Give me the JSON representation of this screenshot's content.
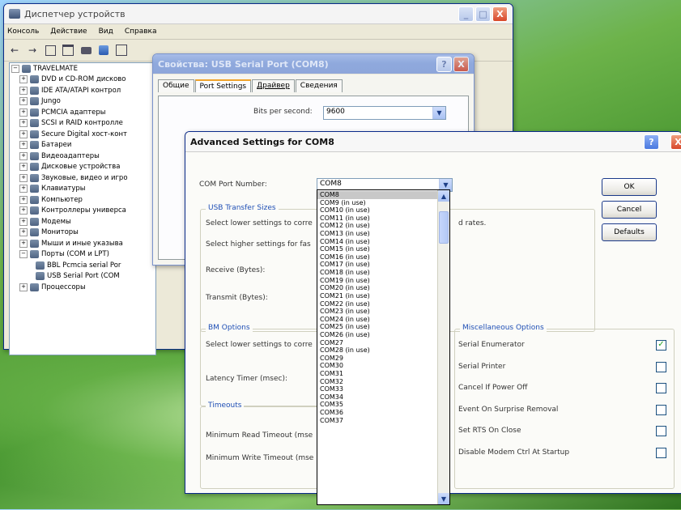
{
  "device_manager": {
    "title": "Диспетчер устройств",
    "menu": [
      "Консоль",
      "Действие",
      "Вид",
      "Справка"
    ],
    "tree": [
      {
        "label": "TRAVELMATE",
        "root": true
      },
      {
        "label": "DVD и CD-ROM дисково"
      },
      {
        "label": "IDE ATA/ATAPI контрол"
      },
      {
        "label": "Jungo"
      },
      {
        "label": "PCMCIA адаптеры"
      },
      {
        "label": "SCSI и RAID контролле"
      },
      {
        "label": "Secure Digital хост-конт"
      },
      {
        "label": "Батареи"
      },
      {
        "label": "Видеоадаптеры"
      },
      {
        "label": "Дисковые устройства"
      },
      {
        "label": "Звуковые, видео и игро"
      },
      {
        "label": "Клавиатуры"
      },
      {
        "label": "Компьютер"
      },
      {
        "label": "Контроллеры универса"
      },
      {
        "label": "Модемы"
      },
      {
        "label": "Мониторы"
      },
      {
        "label": "Мыши и иные указыва"
      },
      {
        "label": "Порты (COM и LPT)"
      },
      {
        "label": "BBL Pcmcia serial Por",
        "child": true
      },
      {
        "label": "USB Serial Port (COM",
        "child": true
      },
      {
        "label": "Процессоры"
      }
    ]
  },
  "properties": {
    "title": "Свойства: USB Serial Port (COM8)",
    "help": "?",
    "close": "X",
    "tabs": [
      "Общие",
      "Port Settings",
      "Драйвер",
      "Сведения"
    ],
    "bits_label": "Bits per second:",
    "bits_value": "9600"
  },
  "advanced": {
    "title": "Advanced Settings for COM8",
    "help": "?",
    "com_port_label": "COM Port Number:",
    "com_port_value": "COM8",
    "usb_section": "USB Transfer Sizes",
    "usb_line1": "Select lower settings to corre",
    "usb_line1_tail": "d rates.",
    "usb_line2": "Select higher settings for fas",
    "receive_label": "Receive (Bytes):",
    "transmit_label": "Transmit (Bytes):",
    "bm_section": "BM Options",
    "bm_line": "Select lower settings to corre",
    "latency_label": "Latency Timer (msec):",
    "timeouts_section": "Timeouts",
    "min_read_label": "Minimum Read Timeout (mse",
    "min_write_label": "Minimum Write Timeout (mse",
    "misc_section": "Miscellaneous Options",
    "misc_options": [
      {
        "label": "Serial Enumerator",
        "checked": true
      },
      {
        "label": "Serial Printer",
        "checked": false
      },
      {
        "label": "Cancel If Power Off",
        "checked": false
      },
      {
        "label": "Event On Surprise Removal",
        "checked": false
      },
      {
        "label": "Set RTS On Close",
        "checked": false
      },
      {
        "label": "Disable Modem Ctrl At Startup",
        "checked": false
      }
    ],
    "buttons": {
      "ok": "OK",
      "cancel": "Cancel",
      "defaults": "Defaults"
    }
  },
  "com_list": [
    "COM8",
    "COM9 (in use)",
    "COM10 (in use)",
    "COM11 (in use)",
    "COM12 (in use)",
    "COM13 (in use)",
    "COM14 (in use)",
    "COM15 (in use)",
    "COM16 (in use)",
    "COM17 (in use)",
    "COM18 (in use)",
    "COM19 (in use)",
    "COM20 (in use)",
    "COM21 (in use)",
    "COM22 (in use)",
    "COM23 (in use)",
    "COM24 (in use)",
    "COM25 (in use)",
    "COM26 (in use)",
    "COM27",
    "COM28 (in use)",
    "COM29",
    "COM30",
    "COM31",
    "COM32",
    "COM33",
    "COM34",
    "COM35",
    "COM36",
    "COM37"
  ],
  "icons": {
    "check": "✓",
    "up": "▲",
    "down": "▼",
    "combo_arrow": "▼",
    "back": "←",
    "forward": "→",
    "minimize": "_",
    "maximize": "□",
    "close": "X",
    "plus": "+",
    "minus": "−"
  }
}
